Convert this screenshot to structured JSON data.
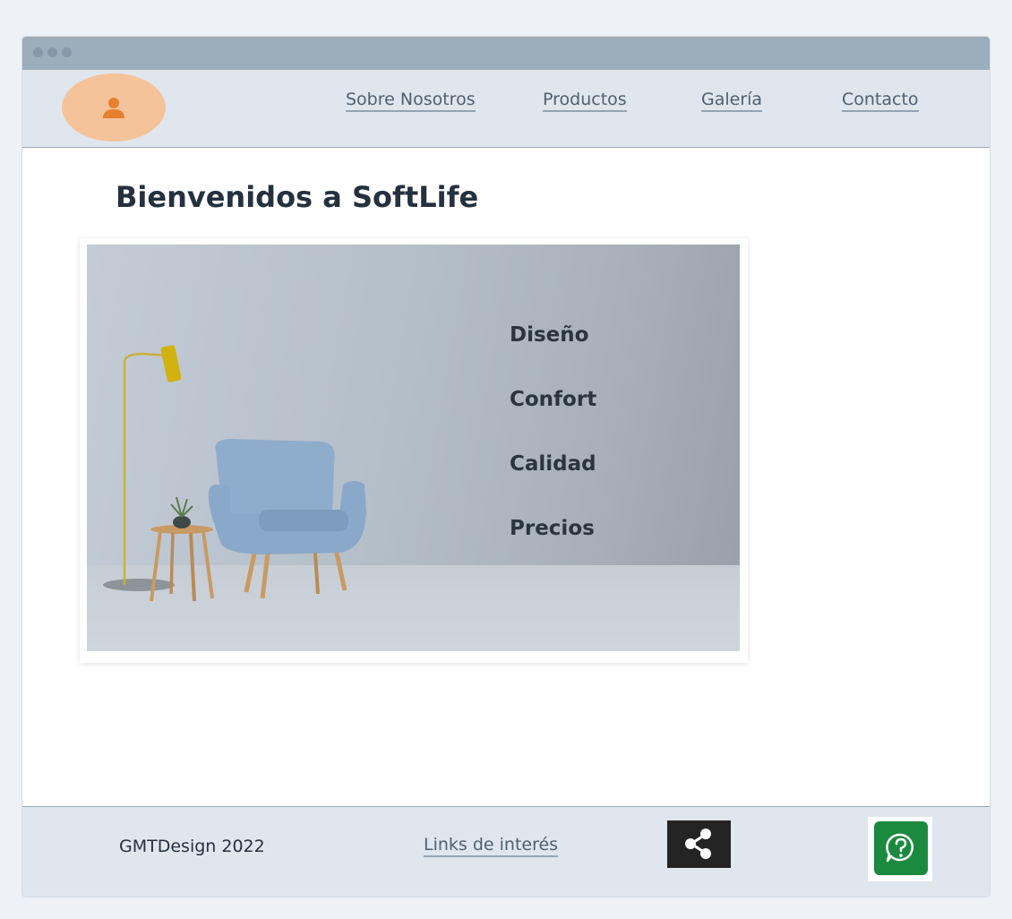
{
  "header": {
    "logo_icon": "user-icon",
    "nav": [
      {
        "label": "Sobre Nosotros"
      },
      {
        "label": "Productos"
      },
      {
        "label": "Galería"
      },
      {
        "label": "Contacto"
      }
    ]
  },
  "main": {
    "title": "Bienvenidos a SoftLife",
    "hero_image": "armchair-room-photo",
    "features": [
      "Diseño",
      "Confort",
      "Calidad",
      "Precios"
    ]
  },
  "footer": {
    "copyright": "GMTDesign 2022",
    "links_label": "Links de interés",
    "share_icon": "share-icon",
    "help_icon": "help-chat-icon"
  },
  "colors": {
    "page_bg": "#eef2f6",
    "titlebar": "#9cadbb",
    "header_bg": "#dfe6ee",
    "logo_bg": "#f5c39a",
    "logo_icon": "#e8802f",
    "title_text": "#25313e",
    "share_bg": "#242424",
    "help_bg": "#1b8a3e"
  }
}
